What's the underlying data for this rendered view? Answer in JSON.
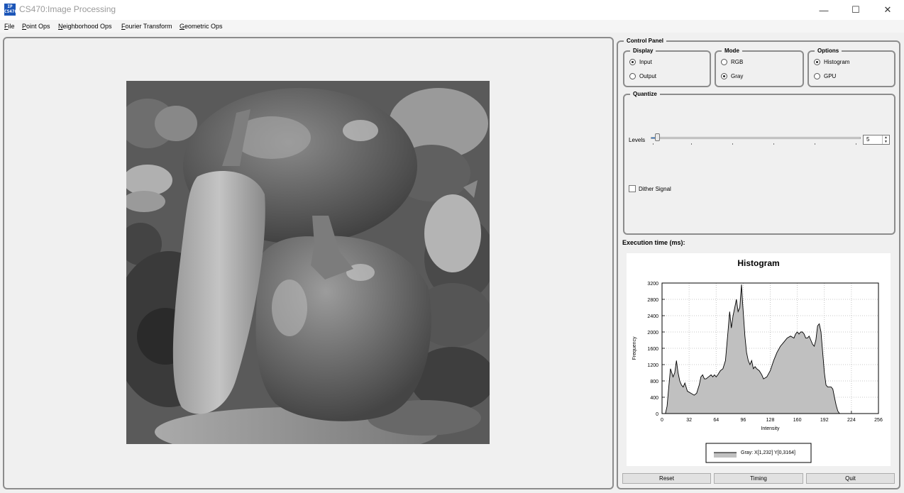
{
  "window": {
    "app_icon_text": "IP CS470",
    "title": "CS470:Image Processing",
    "minimize": "—",
    "maximize": "☐",
    "close": "✕"
  },
  "menu": [
    "File",
    "Point Ops",
    "Neighborhood Ops",
    "Fourier Transform",
    "Geometric Ops"
  ],
  "control_panel": {
    "title": "Control Panel",
    "display": {
      "title": "Display",
      "options": [
        "Input",
        "Output"
      ],
      "selected": "Input"
    },
    "mode": {
      "title": "Mode",
      "options": [
        "RGB",
        "Gray"
      ],
      "selected": "Gray"
    },
    "options": {
      "title": "Options",
      "items": [
        "Histogram",
        "GPU"
      ],
      "selected": "Histogram"
    },
    "quantize": {
      "title": "Quantize",
      "levels_label": "Levels",
      "levels_value": "5",
      "dither_label": "Dither Signal",
      "dither_checked": false
    },
    "execution_label": "Execution time (ms):"
  },
  "buttons": {
    "reset": "Reset",
    "timing": "Timing",
    "quit": "Quit"
  },
  "chart_data": {
    "type": "area",
    "title": "Histogram",
    "xlabel": "Intensity",
    "ylabel": "Frequency",
    "xlim": [
      0,
      256
    ],
    "ylim": [
      0,
      3200
    ],
    "xticks": [
      0,
      32,
      64,
      96,
      128,
      160,
      192,
      224,
      256
    ],
    "yticks": [
      0,
      400,
      800,
      1200,
      1600,
      2000,
      2400,
      2800,
      3200
    ],
    "grid": true,
    "legend_text": "Gray: X[1,232] Y[0,3164]",
    "legend_placement": "bottom-center",
    "series": [
      {
        "name": "Gray",
        "color": "#c0c0c0",
        "x": [
          0,
          4,
          6,
          8,
          10,
          13,
          15,
          17,
          19,
          21,
          23,
          25,
          27,
          30,
          34,
          38,
          41,
          44,
          46,
          48,
          50,
          52,
          55,
          58,
          60,
          62,
          64,
          66,
          69,
          72,
          75,
          78,
          80,
          82,
          84,
          86,
          88,
          90,
          92,
          94,
          95,
          96,
          97,
          98,
          100,
          102,
          104,
          106,
          108,
          110,
          112,
          115,
          118,
          120,
          124,
          128,
          132,
          136,
          140,
          144,
          148,
          152,
          156,
          158,
          160,
          162,
          164,
          166,
          168,
          170,
          172,
          174,
          176,
          178,
          180,
          182,
          184,
          186,
          188,
          190,
          192,
          194,
          196,
          198,
          200,
          202,
          204,
          206,
          208,
          210,
          212,
          214,
          216,
          218,
          220,
          222,
          224,
          232
        ],
        "y": [
          0,
          0,
          180,
          650,
          1100,
          900,
          1000,
          1300,
          1000,
          800,
          700,
          650,
          750,
          550,
          500,
          450,
          500,
          700,
          900,
          950,
          850,
          850,
          900,
          950,
          900,
          950,
          900,
          950,
          1050,
          1100,
          1300,
          2000,
          2500,
          2100,
          2400,
          2600,
          2800,
          2500,
          2600,
          3164,
          2800,
          2500,
          2200,
          1900,
          1500,
          1300,
          1200,
          1300,
          1100,
          1150,
          1100,
          1050,
          950,
          850,
          900,
          1050,
          1300,
          1500,
          1650,
          1750,
          1850,
          1900,
          1850,
          1950,
          2000,
          1950,
          2000,
          2000,
          1950,
          1850,
          1850,
          1900,
          1800,
          1700,
          1650,
          1800,
          2150,
          2200,
          2000,
          1500,
          1000,
          700,
          650,
          650,
          650,
          600,
          400,
          200,
          60,
          0,
          0,
          0,
          0,
          0,
          0,
          0,
          0,
          0
        ]
      }
    ]
  }
}
